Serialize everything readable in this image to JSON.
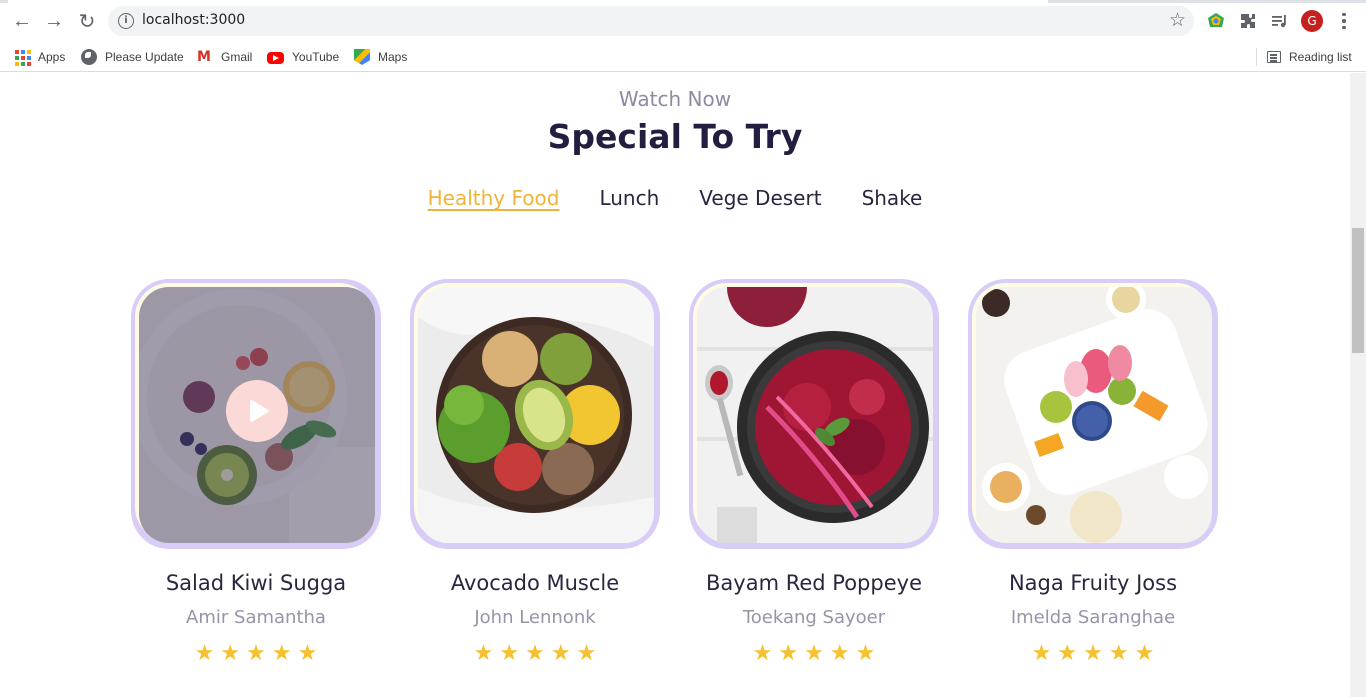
{
  "browser": {
    "url": "localhost:3000",
    "avatar_letter": "G",
    "bookmarks": [
      {
        "label": "Apps",
        "icon": "apps-grid-icon"
      },
      {
        "label": "Please Update",
        "icon": "globe-icon"
      },
      {
        "label": "Gmail",
        "icon": "gmail-icon"
      },
      {
        "label": "YouTube",
        "icon": "youtube-icon"
      },
      {
        "label": "Maps",
        "icon": "maps-icon"
      }
    ],
    "reading_list": "Reading list"
  },
  "section": {
    "subtitle": "Watch Now",
    "title": "Special To Try"
  },
  "tabs": [
    {
      "label": "Healthy Food",
      "active": true
    },
    {
      "label": "Lunch",
      "active": false
    },
    {
      "label": "Vege Desert",
      "active": false
    },
    {
      "label": "Shake",
      "active": false
    }
  ],
  "cards": [
    {
      "name": "Salad Kiwi Sugga",
      "author": "Amir Samantha",
      "rating": 5,
      "has_play_button": true
    },
    {
      "name": "Avocado Muscle",
      "author": "John Lennonk",
      "rating": 5,
      "has_play_button": false
    },
    {
      "name": "Bayam Red Poppeye",
      "author": "Toekang Sayoer",
      "rating": 5,
      "has_play_button": false
    },
    {
      "name": "Naga Fruity Joss",
      "author": "Imelda Saranghae",
      "rating": 5,
      "has_play_button": false
    }
  ],
  "colors": {
    "accent": "#f0b43a",
    "title": "#221e3f",
    "star": "#f5c12e",
    "card_border": "#d9cdf7"
  }
}
